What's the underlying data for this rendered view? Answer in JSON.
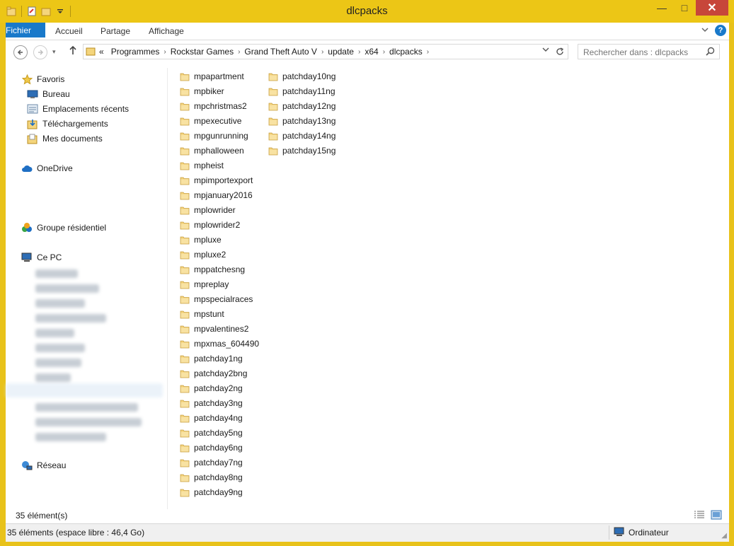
{
  "window": {
    "title": "dlcpacks",
    "minimize": "—",
    "maximize": "□",
    "close": "✕"
  },
  "ribbon": {
    "tabs": [
      "Fichier",
      "Accueil",
      "Partage",
      "Affichage"
    ],
    "help": "?"
  },
  "address": {
    "overflow": "«",
    "segments": [
      "Programmes",
      "Rockstar Games",
      "Grand Theft Auto V",
      "update",
      "x64",
      "dlcpacks"
    ]
  },
  "search": {
    "placeholder": "Rechercher dans : dlcpacks"
  },
  "nav": {
    "favorites": {
      "label": "Favoris",
      "icon": "star-icon"
    },
    "favorites_items": [
      {
        "label": "Bureau",
        "icon": "desktop-icon"
      },
      {
        "label": "Emplacements récents",
        "icon": "recent-places-icon"
      },
      {
        "label": "Téléchargements",
        "icon": "downloads-icon"
      },
      {
        "label": "Mes documents",
        "icon": "documents-icon"
      }
    ],
    "onedrive": {
      "label": "OneDrive",
      "icon": "cloud-icon"
    },
    "homegroup": {
      "label": "Groupe résidentiel",
      "icon": "homegroup-icon"
    },
    "this_pc": {
      "label": "Ce PC",
      "icon": "computer-icon"
    },
    "network": {
      "label": "Réseau",
      "icon": "network-icon"
    }
  },
  "files": {
    "column1": [
      "mpapartment",
      "mpbiker",
      "mpchristmas2",
      "mpexecutive",
      "mpgunrunning",
      "mphalloween",
      "mpheist",
      "mpimportexport",
      "mpjanuary2016",
      "mplowrider",
      "mplowrider2",
      "mpluxe",
      "mpluxe2",
      "mppatchesng",
      "mpreplay",
      "mpspecialraces",
      "mpstunt",
      "mpvalentines2",
      "mpxmas_604490",
      "patchday1ng",
      "patchday2bng",
      "patchday2ng",
      "patchday3ng",
      "patchday4ng",
      "patchday5ng",
      "patchday6ng",
      "patchday7ng",
      "patchday8ng",
      "patchday9ng"
    ],
    "column2": [
      "patchday10ng",
      "patchday11ng",
      "patchday12ng",
      "patchday13ng",
      "patchday14ng",
      "patchday15ng"
    ]
  },
  "count": "35 élément(s)",
  "status": {
    "left": "35 éléments (espace libre : 46,4 Go)",
    "right": "Ordinateur"
  },
  "colors": {
    "title_bar": "#ecc616",
    "file_tab": "#1979ca",
    "folder": "#e8c25a"
  }
}
